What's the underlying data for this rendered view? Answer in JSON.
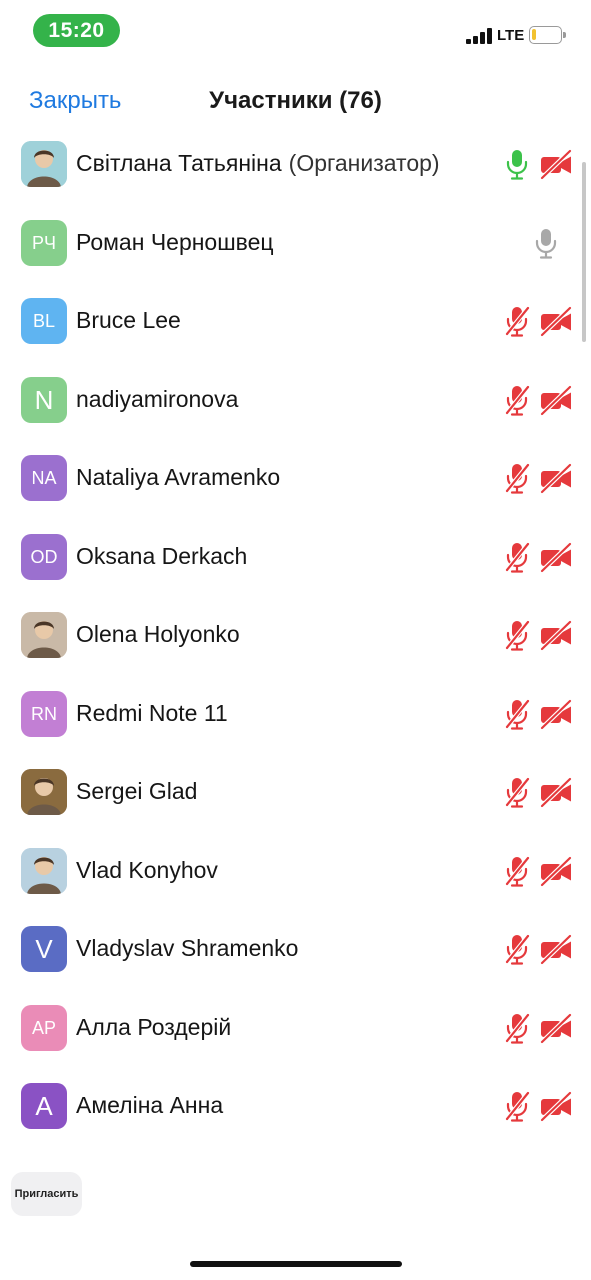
{
  "status_bar": {
    "time": "15:20",
    "network": "LTE",
    "battery_level": 0.15,
    "colors": {
      "time_pill": "#34b34a",
      "battery_fill": "#f2c230"
    }
  },
  "nav": {
    "close_label": "Закрыть",
    "title": "Участники (76)"
  },
  "colors": {
    "accent": "#1f7ae0",
    "muted_red": "#e5393c",
    "unmuted_green": "#3cc24a",
    "idle_gray": "#a8a8a8"
  },
  "participants": [
    {
      "name": "Світлана Татьяніна",
      "role": "(Организатор)",
      "initials": "",
      "avatar_color": "#9fd1d9",
      "photo": true,
      "mic": "on",
      "camera": "off"
    },
    {
      "name": "Роман Черношвец",
      "role": "",
      "initials": "РЧ",
      "avatar_color": "#86cf8c",
      "photo": false,
      "mic": "idle",
      "camera": "none"
    },
    {
      "name": "Bruce Lee",
      "role": "",
      "initials": "BL",
      "avatar_color": "#5fb4f1",
      "photo": false,
      "mic": "off",
      "camera": "off"
    },
    {
      "name": "nadiyamironova",
      "role": "",
      "initials": "N",
      "avatar_color": "#86cf8c",
      "photo": false,
      "mic": "off",
      "camera": "off"
    },
    {
      "name": "Nataliya Avramenko",
      "role": "",
      "initials": "NA",
      "avatar_color": "#9b70cf",
      "photo": false,
      "mic": "off",
      "camera": "off"
    },
    {
      "name": "Oksana Derkach",
      "role": "",
      "initials": "OD",
      "avatar_color": "#9b70cf",
      "photo": false,
      "mic": "off",
      "camera": "off"
    },
    {
      "name": "Olena Holyonko",
      "role": "",
      "initials": "",
      "avatar_color": "#c9b9a7",
      "photo": true,
      "mic": "off",
      "camera": "off"
    },
    {
      "name": "Redmi Note 11",
      "role": "",
      "initials": "RN",
      "avatar_color": "#c27fd4",
      "photo": false,
      "mic": "off",
      "camera": "off"
    },
    {
      "name": "Sergei Glad",
      "role": "",
      "initials": "",
      "avatar_color": "#8a6b3f",
      "photo": true,
      "mic": "off",
      "camera": "off"
    },
    {
      "name": "Vlad Konyhov",
      "role": "",
      "initials": "",
      "avatar_color": "#b8d1e0",
      "photo": true,
      "mic": "off",
      "camera": "off"
    },
    {
      "name": "Vladyslav Shramenko",
      "role": "",
      "initials": "V",
      "avatar_color": "#5a6cc4",
      "photo": false,
      "mic": "off",
      "camera": "off"
    },
    {
      "name": "Алла Роздерій",
      "role": "",
      "initials": "АР",
      "avatar_color": "#ea8cb7",
      "photo": false,
      "mic": "off",
      "camera": "off"
    },
    {
      "name": "Амеліна Анна",
      "role": "",
      "initials": "А",
      "avatar_color": "#8a52c4",
      "photo": false,
      "mic": "off",
      "camera": "off"
    }
  ],
  "invite": {
    "label": "Пригласить"
  }
}
